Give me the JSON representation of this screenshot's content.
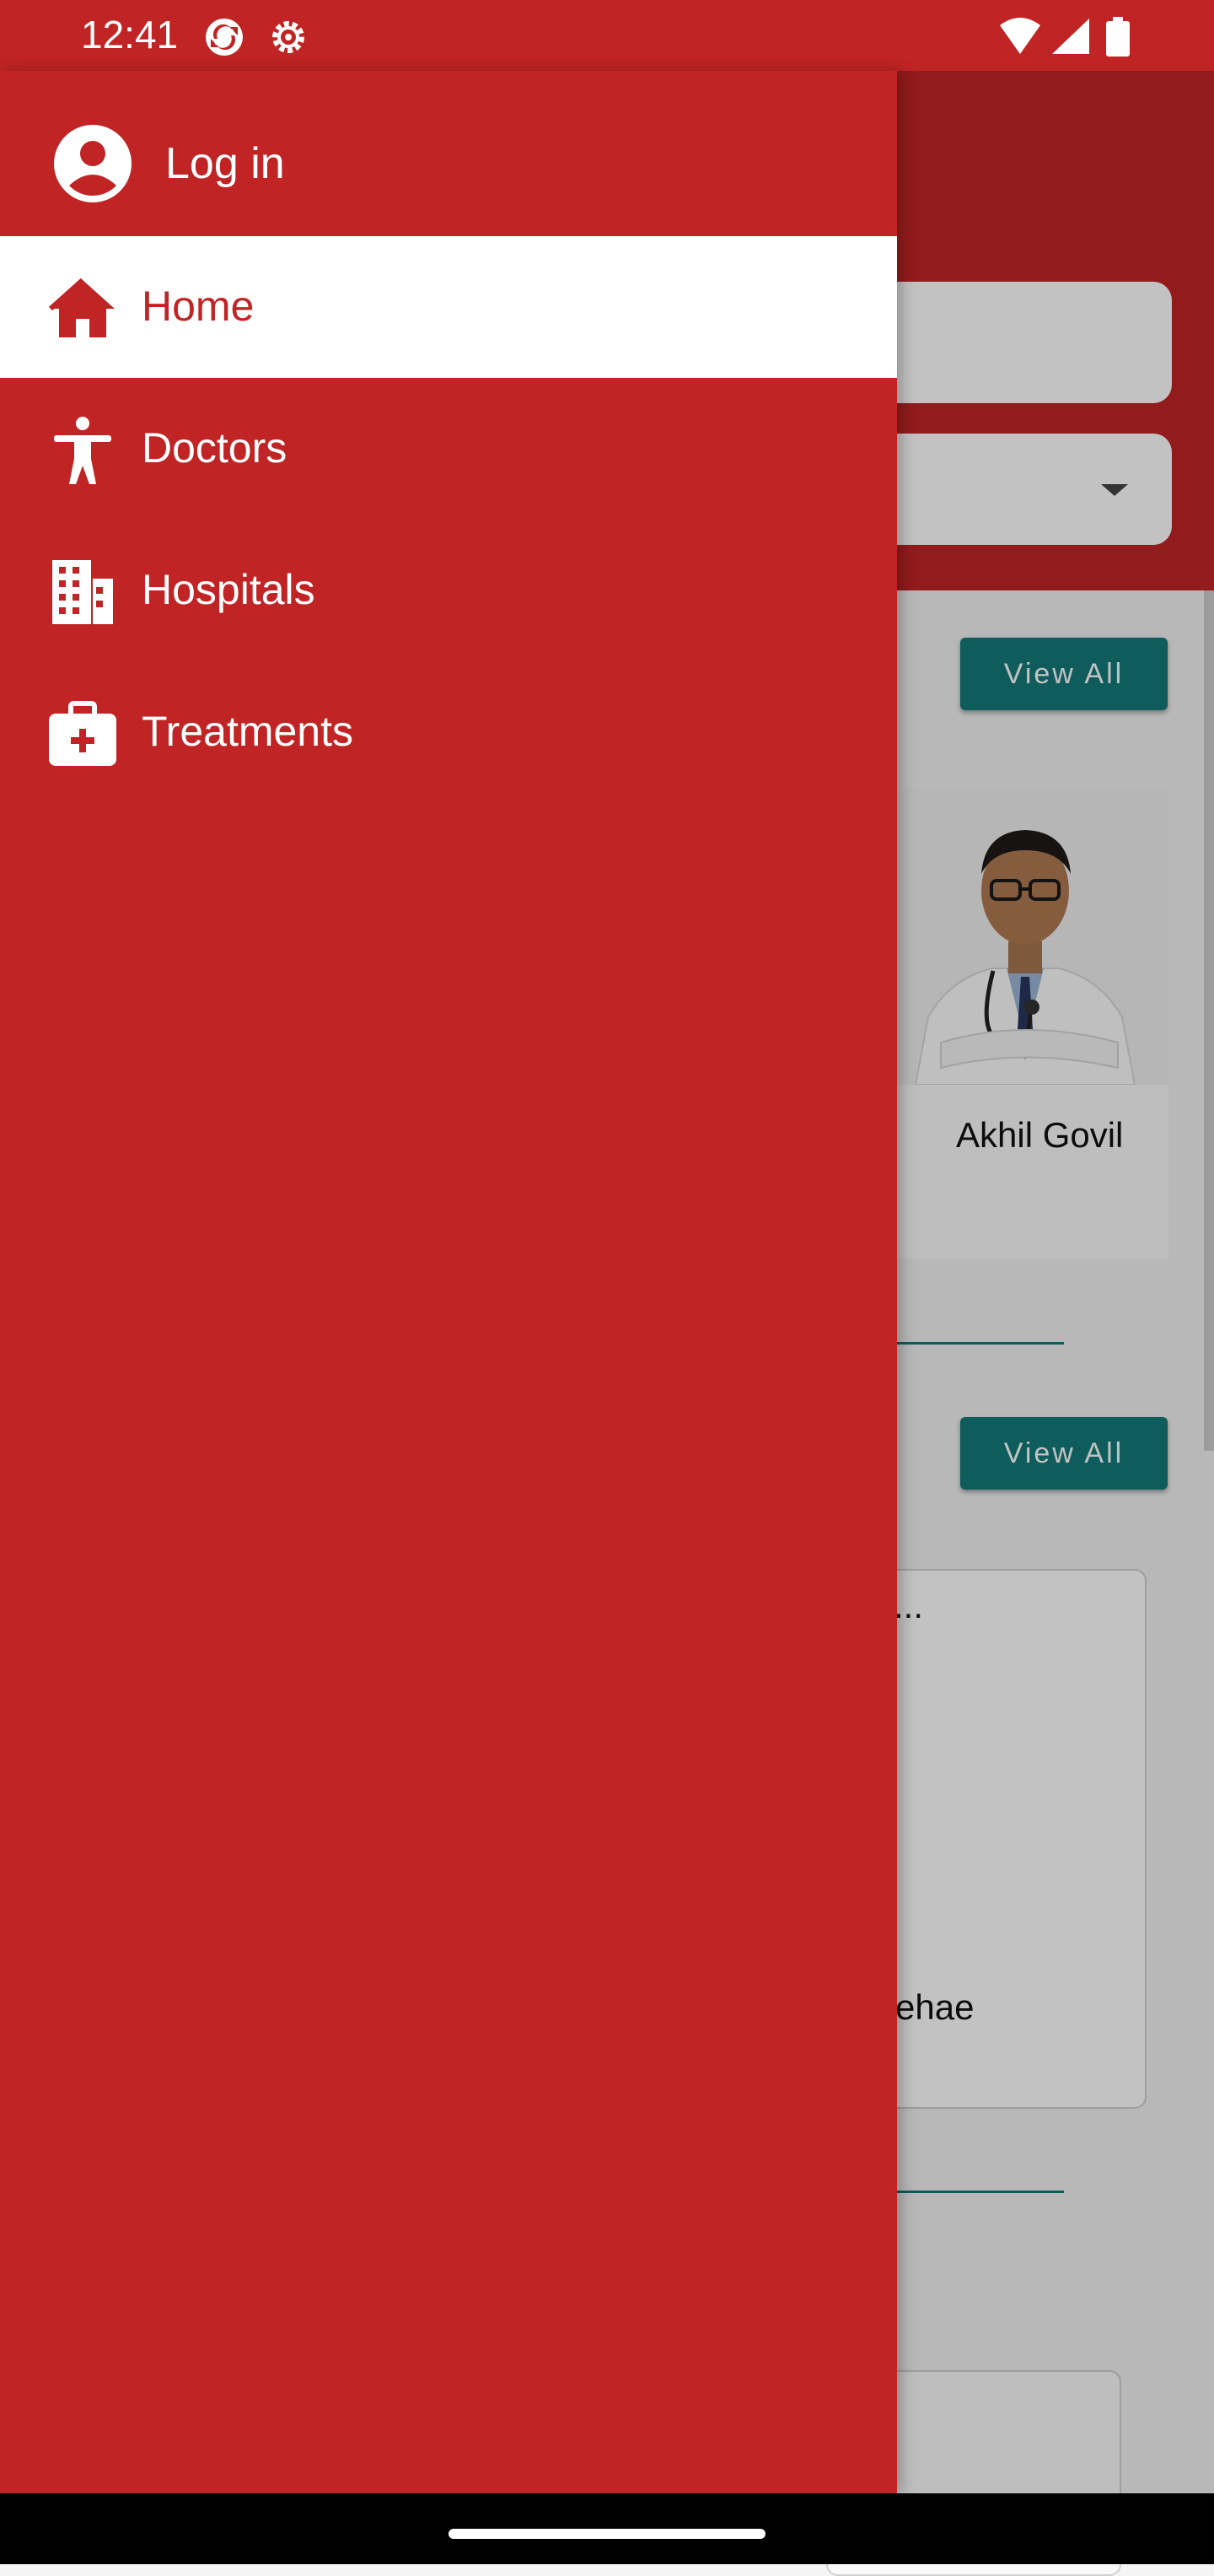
{
  "status_bar": {
    "time": "12:41",
    "left_icons": [
      "sync-icon",
      "settings-gear-icon"
    ],
    "right_icons": [
      "wifi-icon",
      "cellular-signal-icon",
      "battery-icon"
    ]
  },
  "drawer": {
    "login_label": "Log in",
    "items": [
      {
        "label": "Home",
        "icon": "home-icon",
        "active": true
      },
      {
        "label": "Doctors",
        "icon": "person-icon",
        "active": false
      },
      {
        "label": "Hospitals",
        "icon": "building-icon",
        "active": false
      },
      {
        "label": "Treatments",
        "icon": "medical-kit-icon",
        "active": false
      }
    ]
  },
  "background": {
    "view_all_1": "View All",
    "view_all_2": "View All",
    "doctor_name": "Akhil Govil",
    "card_2_title": "...",
    "card_2_name": "ehae"
  },
  "colors": {
    "brand_red": "#c02424",
    "teal": "#137a7a",
    "white": "#ffffff"
  }
}
